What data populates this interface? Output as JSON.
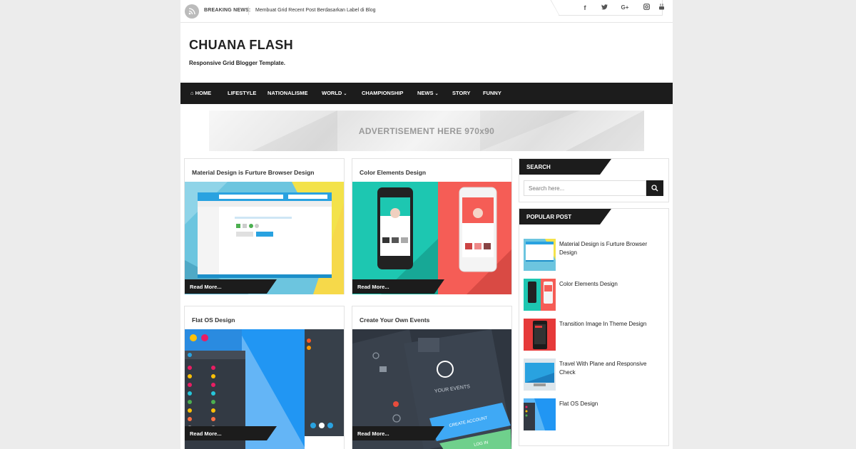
{
  "topbar": {
    "breaking_label": "BREAKING NEWS:",
    "breaking_text": "Membuat Grid Recent Post Berdasarkan Label di Blog",
    "social": [
      "facebook-icon",
      "twitter-icon",
      "google-plus-icon",
      "instagram-icon",
      "youtube-icon"
    ]
  },
  "header": {
    "title": "CHUANA FLASH",
    "tagline": "Responsive Grid Blogger Template."
  },
  "nav": {
    "items": [
      "HOME",
      "LIFESTYLE",
      "NATIONALISME",
      "WORLD",
      "CHAMPIONSHIP",
      "NEWS",
      "STORY",
      "FUNNY"
    ]
  },
  "ad": {
    "text": "ADVERTISEMENT HERE 970x90"
  },
  "posts": [
    {
      "title": "Material Design is Furture Browser Design",
      "readmore": "Read More..."
    },
    {
      "title": "Color Elements Design",
      "readmore": "Read More..."
    },
    {
      "title": "Flat OS Design",
      "readmore": "Read More..."
    },
    {
      "title": "Create Your Own Events",
      "readmore": "Read More..."
    }
  ],
  "thumb_text": {
    "your_events": "YOUR EVENTS",
    "create_account": "CREATE ACCOUNT",
    "log_in": "LOG IN"
  },
  "sidebar": {
    "search": {
      "heading": "SEARCH",
      "placeholder": "Search here..."
    },
    "popular": {
      "heading": "POPULAR POST",
      "items": [
        "Material Design is Furture Browser Design",
        "Color Elements Design",
        "Transition Image In Theme Design",
        "Travel With Plane and Responsive Check",
        "Flat OS Design"
      ]
    }
  },
  "colors": {
    "dark": "#1c1c1c",
    "teal": "#1dc7b1",
    "coral": "#f55d56",
    "blue": "#29a2e0"
  }
}
